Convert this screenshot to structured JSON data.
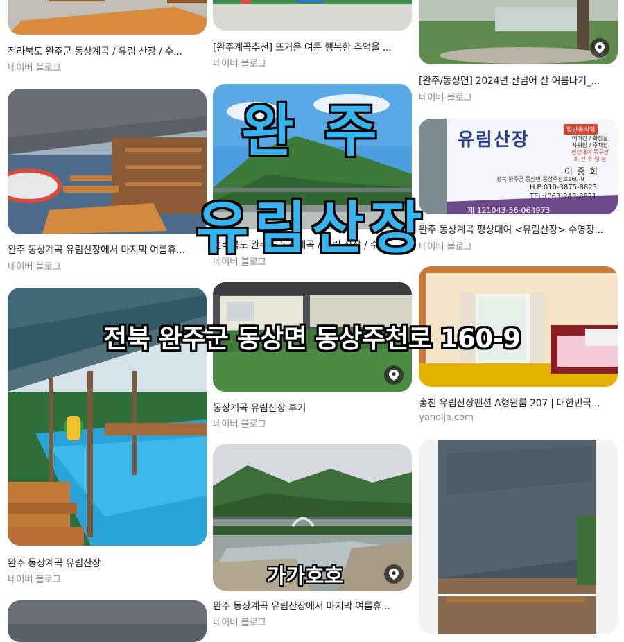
{
  "columns": [
    {
      "cards": [
        {
          "title": "전라북도 완주군 동상계곡 / 유림 산장 / 수...",
          "source": "네이버 블로그",
          "pin": false
        },
        {
          "title": "완주 동상계곡 유림산장에서 마지막 여름휴...",
          "source": "네이버 블로그",
          "pin": false
        },
        {
          "title": "완주 동상계곡 유림산장",
          "source": "네이버 블로그",
          "pin": false
        },
        {
          "title": "",
          "source": "",
          "pin": false
        }
      ]
    },
    {
      "cards": [
        {
          "title": "[완주계곡추천] 뜨거운 여름 행복한 추억을 ...",
          "source": "네이버 블로그",
          "pin": false
        },
        {
          "title": "전라북도 완주군 동상계곡 / 유림 산장 / 수...",
          "source": "네이버 블로그",
          "pin": false
        },
        {
          "title": "동상계곡 유림산장 후기",
          "source": "네이버 블로그",
          "pin": true
        },
        {
          "title": "완주 동상계곡 유림산장에서 마지막 여름휴...",
          "source": "네이버 블로그",
          "pin": true
        }
      ]
    },
    {
      "cards": [
        {
          "title": "[완주/동상면] 2024년 산넘어 산 여름나기_...",
          "source": "네이버 블로그",
          "pin": true
        },
        {
          "title": "완주 동상계곡 평상대여 <유림산장> 수영장...",
          "source": "네이버 블로그",
          "pin": false
        },
        {
          "title": "홍천 유림산장펜션 A형원룸 207 | 대한민국...",
          "source": "yanolja.com",
          "pin": false
        },
        {
          "title": "",
          "source": "",
          "pin": false
        }
      ]
    }
  ],
  "sign": {
    "category": "일반음식점",
    "name": "유림산장",
    "amenities_1": "에어컨 / 화장실",
    "amenities_2": "샤워장 / 주차장",
    "amenities_3": "평상대여 족구장",
    "amenities_4": "회 신 수 영 장",
    "owner": "이 중 희",
    "address": "전북 완주군 동상면 동상주천로160-9",
    "phone_mobile": "H.P:010-3875-8823",
    "phone_tel": "TEL:(063)243-8821",
    "bottom_number": "제 121043-56-064973"
  },
  "overlay": {
    "line1": "완 주",
    "line2": "유림산장",
    "address": "전북 완주군 동상면 동상주천로 160-9",
    "credit": "가가호호"
  },
  "colors": {
    "headline": "#35b4f0",
    "source_text": "#8a8a8a",
    "title_text": "#222222"
  }
}
